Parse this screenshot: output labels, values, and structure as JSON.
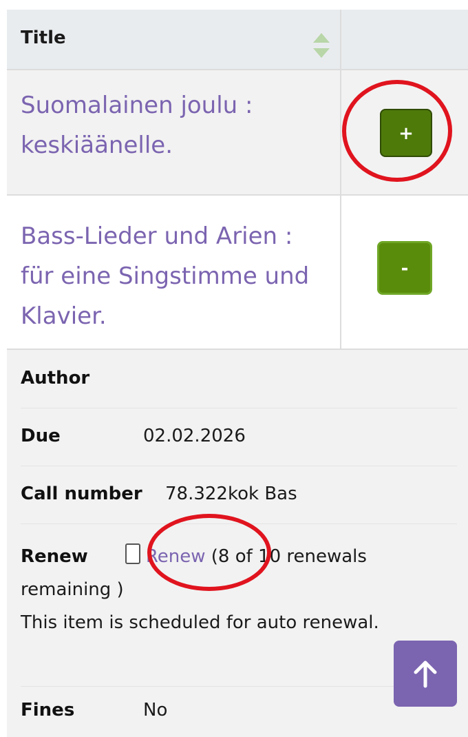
{
  "table": {
    "header": {
      "title_label": "Title",
      "sort_icon": "sort-icon"
    },
    "rows": [
      {
        "title": "Suomalainen joulu : keskiäänelle.",
        "toggle_label": "+",
        "toggle_icon": "plus-icon"
      },
      {
        "title": "Bass-Lieder und Arien : für eine Singstimme und Klavier.",
        "toggle_label": "-",
        "toggle_icon": "minus-icon"
      }
    ]
  },
  "details": {
    "author_label": "Author",
    "due_label": "Due",
    "due_value": "02.02.2026",
    "call_number_label": "Call number",
    "call_number_value": "78.322kok Bas",
    "renew_label": "Renew",
    "renew_link": "Renew",
    "renew_open": "(",
    "renewals_remaining": "8 of 10 renewals remaining )",
    "auto_renewal_note": "This item is scheduled for auto renewal.",
    "fines_label": "Fines",
    "fines_value": "No"
  },
  "scroll_top": {
    "icon": "arrow-up-icon"
  },
  "colors": {
    "link": "#7b64b0",
    "button_green": "#4e7a0a",
    "annotation_red": "#e0141e",
    "scroll_top_bg": "#7b64b0"
  }
}
